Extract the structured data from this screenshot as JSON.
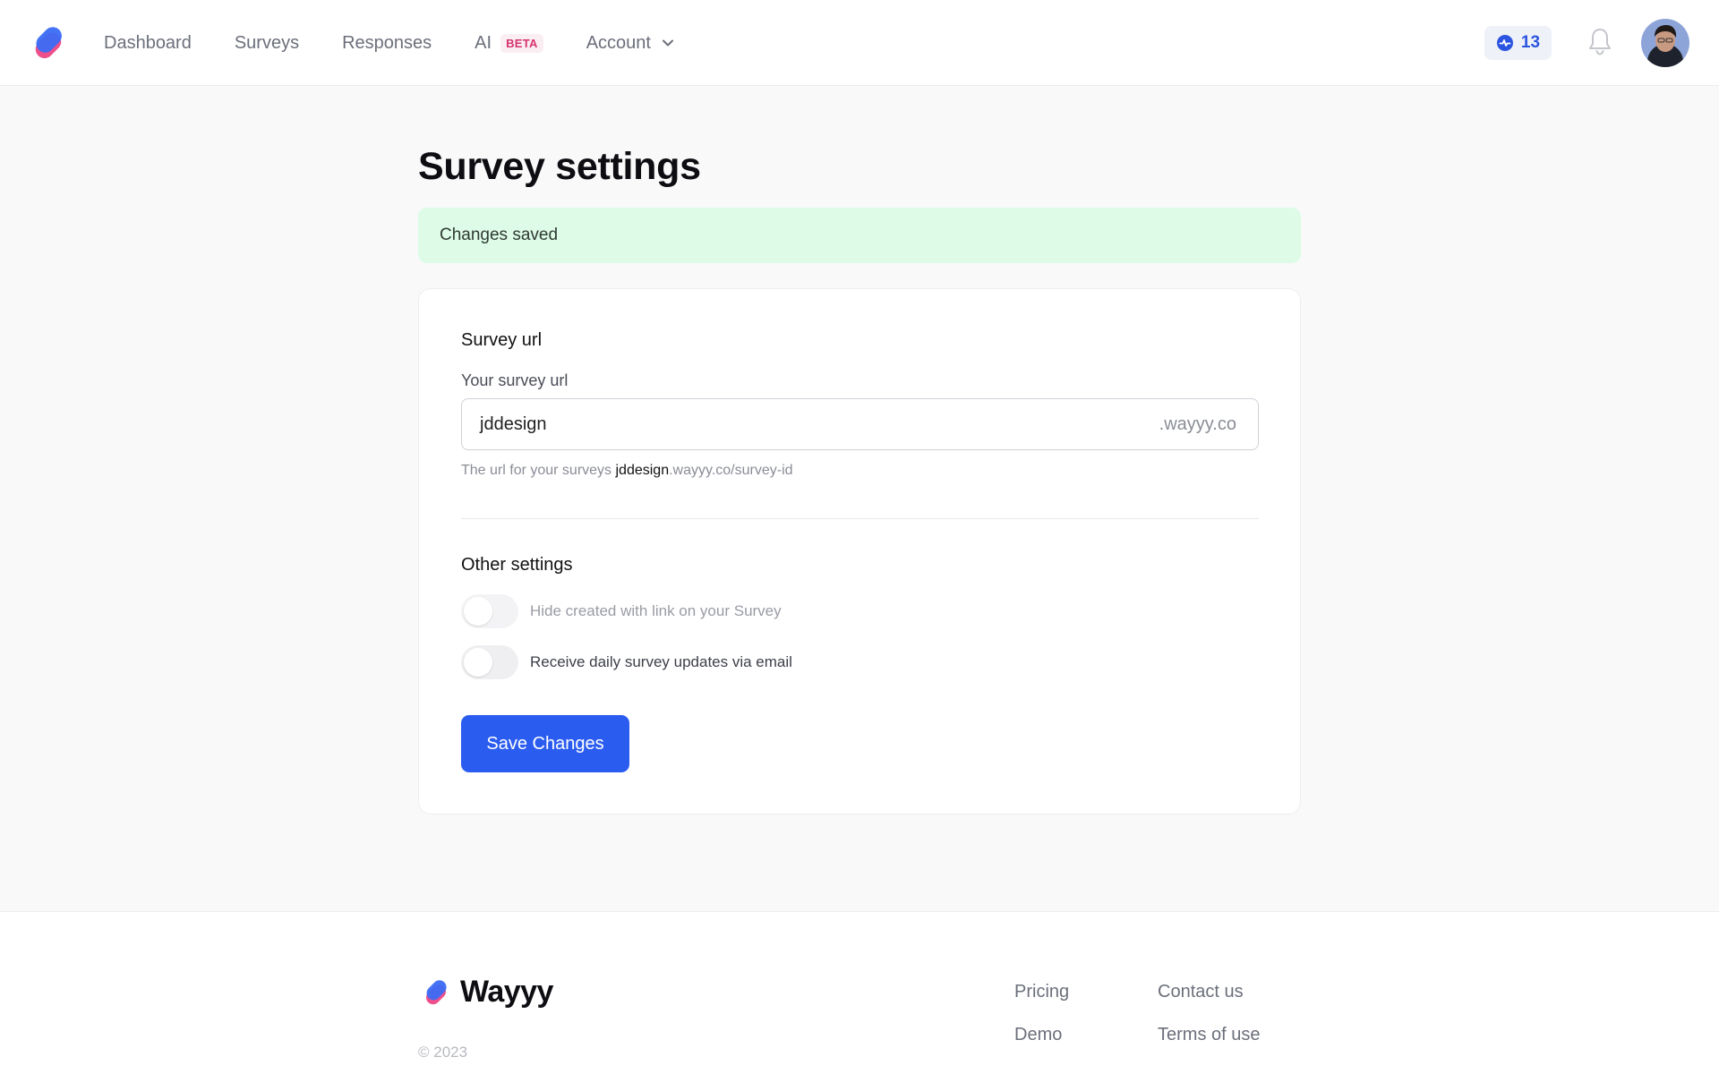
{
  "header": {
    "nav": [
      {
        "label": "Dashboard"
      },
      {
        "label": "Surveys"
      },
      {
        "label": "Responses"
      },
      {
        "label": "AI",
        "badge": "BETA"
      },
      {
        "label": "Account"
      }
    ],
    "credits": "13"
  },
  "main": {
    "title": "Survey settings",
    "alert": "Changes saved",
    "survey_url": {
      "section_title": "Survey url",
      "field_label": "Your survey url",
      "value": "jddesign",
      "suffix": ".wayyy.co",
      "hint_prefix": "The url for your surveys ",
      "hint_subdomain": "jddesign",
      "hint_suffix": ".wayyy.co/survey-id"
    },
    "other_settings": {
      "section_title": "Other settings",
      "toggles": [
        {
          "label": "Hide created with link on your Survey",
          "on": false,
          "disabled": true
        },
        {
          "label": "Receive daily survey updates via email",
          "on": false,
          "disabled": false
        }
      ]
    },
    "save_label": "Save Changes"
  },
  "footer": {
    "brand": "Wayyy",
    "copyright": "© 2023",
    "links_col1": [
      "Pricing",
      "Demo"
    ],
    "links_col2": [
      "Contact us",
      "Terms of use"
    ]
  },
  "colors": {
    "accent": "#2b5cf0",
    "success_bg": "#ddfbe6",
    "logo_pink": "#ee4f8b",
    "logo_blue": "#3b6cf6"
  }
}
